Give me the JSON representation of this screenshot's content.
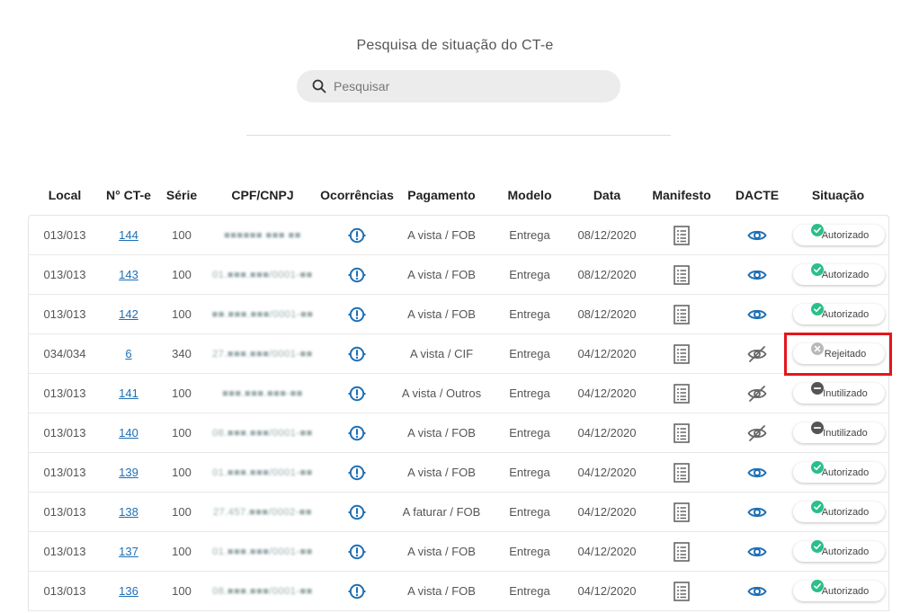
{
  "header": {
    "title": "Pesquisa de situação do CT-e",
    "search_placeholder": "Pesquisar",
    "search_value": ""
  },
  "colors": {
    "accent": "#1e6fb5",
    "success": "#2bbf8a",
    "rejected": "#b9b9b9",
    "inutilizado": "#555555",
    "highlight": "#e5161d"
  },
  "table": {
    "columns": [
      "Local",
      "N° CT-e",
      "Série",
      "CPF/CNPJ",
      "Ocorrências",
      "Pagamento",
      "Modelo",
      "Data",
      "Manifesto",
      "DACTE",
      "Situação"
    ],
    "rows": [
      {
        "local": "013/013",
        "numero": "144",
        "serie": "100",
        "cpf_cnpj": "■■■■■■ ■■■ ■■",
        "pagamento": "A vista / FOB",
        "modelo": "Entrega",
        "data": "08/12/2020",
        "dacte": "eye-icon",
        "situacao": "Autorizado",
        "status_icon": "check-circle-icon"
      },
      {
        "local": "013/013",
        "numero": "143",
        "serie": "100",
        "cpf_cnpj": "01.■■■.■■■/0001-■■",
        "pagamento": "A vista / FOB",
        "modelo": "Entrega",
        "data": "08/12/2020",
        "dacte": "eye-icon",
        "situacao": "Autorizado",
        "status_icon": "check-circle-icon"
      },
      {
        "local": "013/013",
        "numero": "142",
        "serie": "100",
        "cpf_cnpj": "■■.■■■.■■■/0001-■■",
        "pagamento": "A vista / FOB",
        "modelo": "Entrega",
        "data": "08/12/2020",
        "dacte": "eye-icon",
        "situacao": "Autorizado",
        "status_icon": "check-circle-icon"
      },
      {
        "local": "034/034",
        "numero": "6",
        "serie": "340",
        "cpf_cnpj": "27.■■■.■■■/0001-■■",
        "pagamento": "A vista / CIF",
        "modelo": "Entrega",
        "data": "04/12/2020",
        "dacte": "eye-off-icon",
        "situacao": "Rejeitado",
        "status_icon": "x-circle-icon"
      },
      {
        "local": "013/013",
        "numero": "141",
        "serie": "100",
        "cpf_cnpj": "■■■.■■■.■■■-■■",
        "pagamento": "A vista / Outros",
        "modelo": "Entrega",
        "data": "04/12/2020",
        "dacte": "eye-off-icon",
        "situacao": "Inutilizado",
        "status_icon": "minus-circle-icon"
      },
      {
        "local": "013/013",
        "numero": "140",
        "serie": "100",
        "cpf_cnpj": "08.■■■.■■■/0001-■■",
        "pagamento": "A vista / FOB",
        "modelo": "Entrega",
        "data": "04/12/2020",
        "dacte": "eye-off-icon",
        "situacao": "Inutilizado",
        "status_icon": "minus-circle-icon"
      },
      {
        "local": "013/013",
        "numero": "139",
        "serie": "100",
        "cpf_cnpj": "01.■■■.■■■/0001-■■",
        "pagamento": "A vista / FOB",
        "modelo": "Entrega",
        "data": "04/12/2020",
        "dacte": "eye-icon",
        "situacao": "Autorizado",
        "status_icon": "check-circle-icon"
      },
      {
        "local": "013/013",
        "numero": "138",
        "serie": "100",
        "cpf_cnpj": "27.457.■■■/0002-■■",
        "pagamento": "A faturar / FOB",
        "modelo": "Entrega",
        "data": "04/12/2020",
        "dacte": "eye-icon",
        "situacao": "Autorizado",
        "status_icon": "check-circle-icon"
      },
      {
        "local": "013/013",
        "numero": "137",
        "serie": "100",
        "cpf_cnpj": "01.■■■.■■■/0001-■■",
        "pagamento": "A vista / FOB",
        "modelo": "Entrega",
        "data": "04/12/2020",
        "dacte": "eye-icon",
        "situacao": "Autorizado",
        "status_icon": "check-circle-icon"
      },
      {
        "local": "013/013",
        "numero": "136",
        "serie": "100",
        "cpf_cnpj": "08.■■■.■■■/0001-■■",
        "pagamento": "A vista / FOB",
        "modelo": "Entrega",
        "data": "04/12/2020",
        "dacte": "eye-icon",
        "situacao": "Autorizado",
        "status_icon": "check-circle-icon"
      }
    ]
  }
}
